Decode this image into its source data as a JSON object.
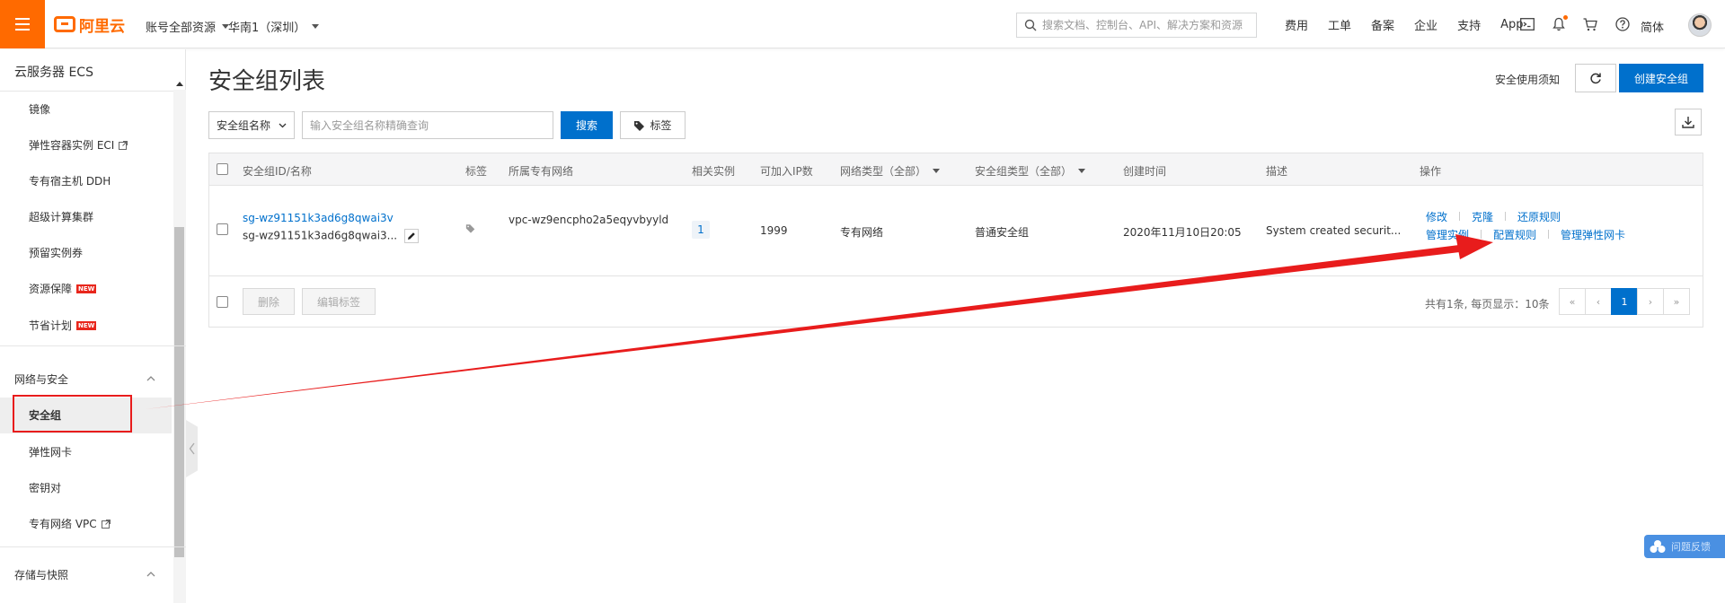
{
  "topbar": {
    "brand": "阿里云",
    "account_scope": "账号全部资源",
    "region": "华南1（深圳）",
    "search_placeholder": "搜索文档、控制台、API、解决方案和资源",
    "links": [
      "费用",
      "工单",
      "备案",
      "企业",
      "支持",
      "App"
    ],
    "icons": [
      "terminal-icon",
      "bell-icon",
      "cart-icon",
      "help-icon"
    ],
    "language": "简体"
  },
  "sidebar": {
    "title": "云服务器 ECS",
    "items_top": [
      {
        "label": "镜像"
      },
      {
        "label": "弹性容器实例 ECI",
        "external": true
      },
      {
        "label": "专有宿主机 DDH"
      },
      {
        "label": "超级计算集群"
      },
      {
        "label": "预留实例券"
      },
      {
        "label": "资源保障",
        "badge": "NEW"
      },
      {
        "label": "节省计划",
        "badge": "NEW"
      }
    ],
    "group_network": "网络与安全",
    "items_network": [
      {
        "label": "安全组",
        "active": true
      },
      {
        "label": "弹性网卡"
      },
      {
        "label": "密钥对"
      },
      {
        "label": "专有网络 VPC",
        "external": true
      }
    ],
    "group_storage": "存储与快照"
  },
  "main": {
    "title": "安全组列表",
    "notice_link": "安全使用须知",
    "create_button": "创建安全组",
    "filter": {
      "field": "安全组名称",
      "placeholder": "输入安全组名称精确查询",
      "search_button": "搜索",
      "tag_button": "标签"
    },
    "table": {
      "columns": [
        "安全组ID/名称",
        "标签",
        "所属专有网络",
        "相关实例",
        "可加入IP数",
        "网络类型（全部）",
        "安全组类型（全部）",
        "创建时间",
        "描述",
        "操作"
      ],
      "rows": [
        {
          "id": "sg-wz91151k3ad6g8qwai3v",
          "name": "sg-wz91151k3ad6g8qwai3...",
          "vpc": "vpc-wz9encpho2a5eqyvbyyld",
          "instances": "1",
          "ip_count": "1999",
          "network_type": "专有网络",
          "sg_type": "普通安全组",
          "created": "2020年11月10日20:05",
          "description": "System created securit...",
          "actions_row1": [
            "修改",
            "克隆",
            "还原规则"
          ],
          "actions_row2": [
            "管理实例",
            "配置规则",
            "管理弹性网卡"
          ]
        }
      ]
    },
    "footer": {
      "delete_button": "删除",
      "edit_tags_button": "编辑标签",
      "page_info": "共有1条, 每页显示：10条",
      "pager": [
        "«",
        "‹",
        "1",
        "›",
        "»"
      ],
      "current_page": "1"
    }
  },
  "widget": {
    "label": "问题反馈"
  },
  "annotation_color": "#e81c1c",
  "accent_color": "#0070cc",
  "brand_color": "#ff6a00"
}
